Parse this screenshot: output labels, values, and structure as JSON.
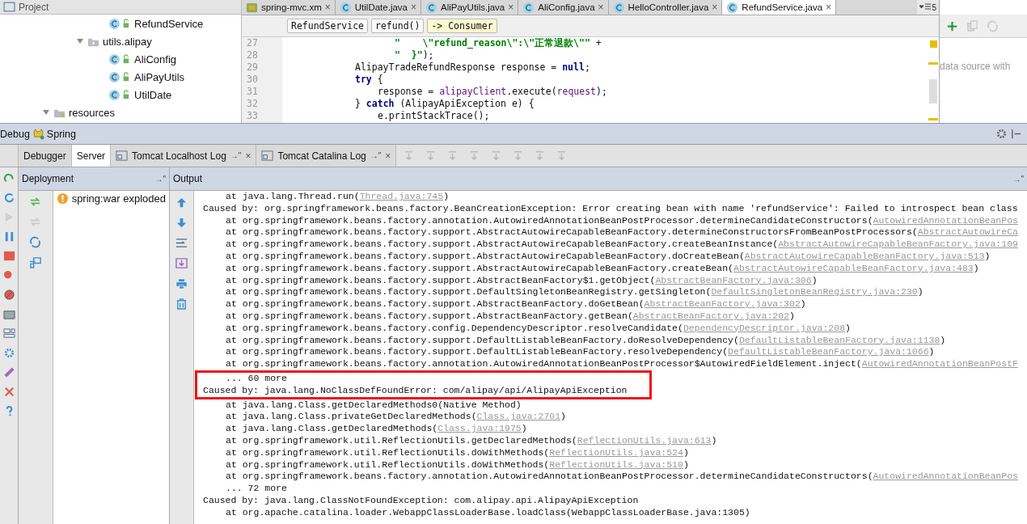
{
  "project_panel": {
    "title": "Project",
    "tree": [
      {
        "kind": "class",
        "label": "RefundService"
      },
      {
        "kind": "package",
        "label": "utils.alipay",
        "expanded": true,
        "children": [
          {
            "kind": "class",
            "label": "AliConfig"
          },
          {
            "kind": "class",
            "label": "AliPayUtils"
          },
          {
            "kind": "class",
            "label": "UtilDate"
          }
        ]
      }
    ],
    "tree_outer": [
      {
        "kind": "resources",
        "label": "resources",
        "expanded": true
      }
    ]
  },
  "editor": {
    "tabs": [
      {
        "label": "spring-mvc.xm",
        "kind": "xml",
        "close": "×",
        "selected": false
      },
      {
        "label": "UtilDate.java",
        "kind": "class",
        "close": "×",
        "selected": false
      },
      {
        "label": "AliPayUtils.java",
        "kind": "class",
        "close": "×",
        "selected": false
      },
      {
        "label": "AliConfig.java",
        "kind": "class",
        "close": "×",
        "selected": false
      },
      {
        "label": "HelloController.java",
        "kind": "class",
        "close": "×",
        "selected": false
      },
      {
        "label": "RefundService.java",
        "kind": "class",
        "close": "×",
        "selected": true
      }
    ],
    "tab_overflow": "5",
    "breadcrumbs": [
      {
        "label": "RefundService",
        "selected": false
      },
      {
        "label": "refund()",
        "selected": false
      },
      {
        "label": "-> Consumer",
        "selected": true
      }
    ],
    "lines": [
      {
        "number": "27",
        "kind": "continuation",
        "segments": [
          {
            "kind": "string",
            "text": "\"    \\\"refund_reason\\\":\\\"正常退款\\\"\""
          },
          {
            "kind": "plain",
            "text": " +"
          }
        ]
      },
      {
        "number": "28",
        "kind": "continuation",
        "segments": [
          {
            "kind": "string",
            "text": "\"  }\""
          },
          {
            "kind": "plain",
            "text": ");"
          }
        ]
      },
      {
        "number": "29",
        "kind": "statement",
        "segments": [
          {
            "kind": "plain",
            "text": "AlipayTradeRefundResponse response = "
          },
          {
            "kind": "keyword",
            "text": "null"
          },
          {
            "kind": "plain",
            "text": ";"
          }
        ]
      },
      {
        "number": "30",
        "kind": "statement",
        "segments": [
          {
            "kind": "keyword",
            "text": "try"
          },
          {
            "kind": "plain",
            "text": " {"
          }
        ]
      },
      {
        "number": "31",
        "kind": "block",
        "segments": [
          {
            "kind": "plain",
            "text": "response = "
          },
          {
            "kind": "field",
            "text": "alipayClient"
          },
          {
            "kind": "plain",
            "text": ".execute("
          },
          {
            "kind": "field",
            "text": "request"
          },
          {
            "kind": "plain",
            "text": ");"
          }
        ]
      },
      {
        "number": "32",
        "kind": "statement",
        "segments": [
          {
            "kind": "plain",
            "text": "} "
          },
          {
            "kind": "keyword",
            "text": "catch"
          },
          {
            "kind": "plain",
            "text": " (AlipayApiException e) {"
          }
        ]
      },
      {
        "number": "33",
        "kind": "block",
        "segments": [
          {
            "kind": "plain",
            "text": "e.printStackTrace();"
          }
        ]
      }
    ]
  },
  "side_panel": {
    "hint": "data source with"
  },
  "debug": {
    "title": "Debug",
    "config": "Spring",
    "tabs": [
      {
        "label": "Debugger",
        "kind": "plain",
        "selected": false
      },
      {
        "label": "Server",
        "kind": "plain",
        "selected": true
      },
      {
        "label": "Tomcat Localhost Log",
        "kind": "log",
        "pin": "→\"",
        "close": "×",
        "selected": false
      },
      {
        "label": "Tomcat Catalina Log",
        "kind": "log",
        "pin": "→\"",
        "close": "×",
        "selected": false
      }
    ],
    "deployment": {
      "title": "Deployment",
      "pin": "→\"",
      "items": [
        {
          "label": "spring:war exploded",
          "kind": "warning"
        }
      ]
    },
    "output": {
      "title": "Output",
      "pin": "→\"",
      "lines": [
        {
          "kind": "frame",
          "text": "at java.lang.Thread.run(",
          "link": "Thread.java:745",
          "tail": ")",
          "highlighted": false
        },
        {
          "kind": "cause",
          "text": "Caused by: org.springframework.beans.factory.BeanCreationException: Error creating bean with name 'refundService': Failed to introspect bean class",
          "highlighted": false
        },
        {
          "kind": "frame",
          "text": "at org.springframework.beans.factory.annotation.AutowiredAnnotationBeanPostProcessor.determineCandidateConstructors(",
          "link": "AutowiredAnnotationBeanPos",
          "highlighted": false
        },
        {
          "kind": "frame",
          "text": "at org.springframework.beans.factory.support.AbstractAutowireCapableBeanFactory.determineConstructorsFromBeanPostProcessors(",
          "link": "AbstractAutowireCa",
          "highlighted": false
        },
        {
          "kind": "frame",
          "text": "at org.springframework.beans.factory.support.AbstractAutowireCapableBeanFactory.createBeanInstance(",
          "link": "AbstractAutowireCapableBeanFactory.java:109",
          "highlighted": false
        },
        {
          "kind": "frame",
          "text": "at org.springframework.beans.factory.support.AbstractAutowireCapableBeanFactory.doCreateBean(",
          "link": "AbstractAutowireCapableBeanFactory.java:513",
          "tail": ")",
          "highlighted": false
        },
        {
          "kind": "frame",
          "text": "at org.springframework.beans.factory.support.AbstractAutowireCapableBeanFactory.createBean(",
          "link": "AbstractAutowireCapableBeanFactory.java:483",
          "tail": ")",
          "highlighted": false
        },
        {
          "kind": "frame",
          "text": "at org.springframework.beans.factory.support.AbstractBeanFactory$1.getObject(",
          "link": "AbstractBeanFactory.java:306",
          "tail": ")",
          "highlighted": false
        },
        {
          "kind": "frame",
          "text": "at org.springframework.beans.factory.support.DefaultSingletonBeanRegistry.getSingleton(",
          "link": "DefaultSingletonBeanRegistry.java:230",
          "tail": ")",
          "highlighted": false
        },
        {
          "kind": "frame",
          "text": "at org.springframework.beans.factory.support.AbstractBeanFactory.doGetBean(",
          "link": "AbstractBeanFactory.java:302",
          "tail": ")",
          "highlighted": false
        },
        {
          "kind": "frame",
          "text": "at org.springframework.beans.factory.support.AbstractBeanFactory.getBean(",
          "link": "AbstractBeanFactory.java:202",
          "tail": ")",
          "highlighted": false
        },
        {
          "kind": "frame",
          "text": "at org.springframework.beans.factory.config.DependencyDescriptor.resolveCandidate(",
          "link": "DependencyDescriptor.java:208",
          "tail": ")",
          "highlighted": false
        },
        {
          "kind": "frame",
          "text": "at org.springframework.beans.factory.support.DefaultListableBeanFactory.doResolveDependency(",
          "link": "DefaultListableBeanFactory.java:1138",
          "tail": ")",
          "highlighted": false
        },
        {
          "kind": "frame",
          "text": "at org.springframework.beans.factory.support.DefaultListableBeanFactory.resolveDependency(",
          "link": "DefaultListableBeanFactory.java:1066",
          "tail": ")",
          "highlighted": false
        },
        {
          "kind": "frame",
          "text": "at org.springframework.beans.factory.annotation.AutowiredAnnotationBeanPostProcessor$AutowiredFieldElement.inject(",
          "link": "AutowiredAnnotationBeanPostF",
          "highlighted": false
        },
        {
          "kind": "more",
          "text": "... 60 more",
          "highlighted": true
        },
        {
          "kind": "cause",
          "text": "Caused by: java.lang.NoClassDefFoundError: com/alipay/api/AlipayApiException",
          "highlighted": true
        },
        {
          "kind": "frame",
          "text": "at java.lang.Class.getDeclaredMethods0(Native Method)",
          "highlighted": false
        },
        {
          "kind": "frame",
          "text": "at java.lang.Class.privateGetDeclaredMethods(",
          "link": "Class.java:2701",
          "tail": ")",
          "highlighted": false
        },
        {
          "kind": "frame",
          "text": "at java.lang.Class.getDeclaredMethods(",
          "link": "Class.java:1975",
          "tail": ")",
          "highlighted": false
        },
        {
          "kind": "frame",
          "text": "at org.springframework.util.ReflectionUtils.getDeclaredMethods(",
          "link": "ReflectionUtils.java:613",
          "tail": ")",
          "highlighted": false
        },
        {
          "kind": "frame",
          "text": "at org.springframework.util.ReflectionUtils.doWithMethods(",
          "link": "ReflectionUtils.java:524",
          "tail": ")",
          "highlighted": false
        },
        {
          "kind": "frame",
          "text": "at org.springframework.util.ReflectionUtils.doWithMethods(",
          "link": "ReflectionUtils.java:510",
          "tail": ")",
          "highlighted": false
        },
        {
          "kind": "frame",
          "text": "at org.springframework.beans.factory.annotation.AutowiredAnnotationBeanPostProcessor.determineCandidateConstructors(",
          "link": "AutowiredAnnotationBeanPos",
          "highlighted": false
        },
        {
          "kind": "more",
          "text": "... 72 more",
          "highlighted": false
        },
        {
          "kind": "cause",
          "text": "Caused by: java.lang.ClassNotFoundException: com.alipay.api.AlipayApiException",
          "highlighted": false
        },
        {
          "kind": "frame",
          "text": "at org.apache.catalina.loader.WebappClassLoaderBase.loadClass(WebappClassLoaderBase.java:1305)",
          "highlighted": false
        }
      ]
    }
  }
}
